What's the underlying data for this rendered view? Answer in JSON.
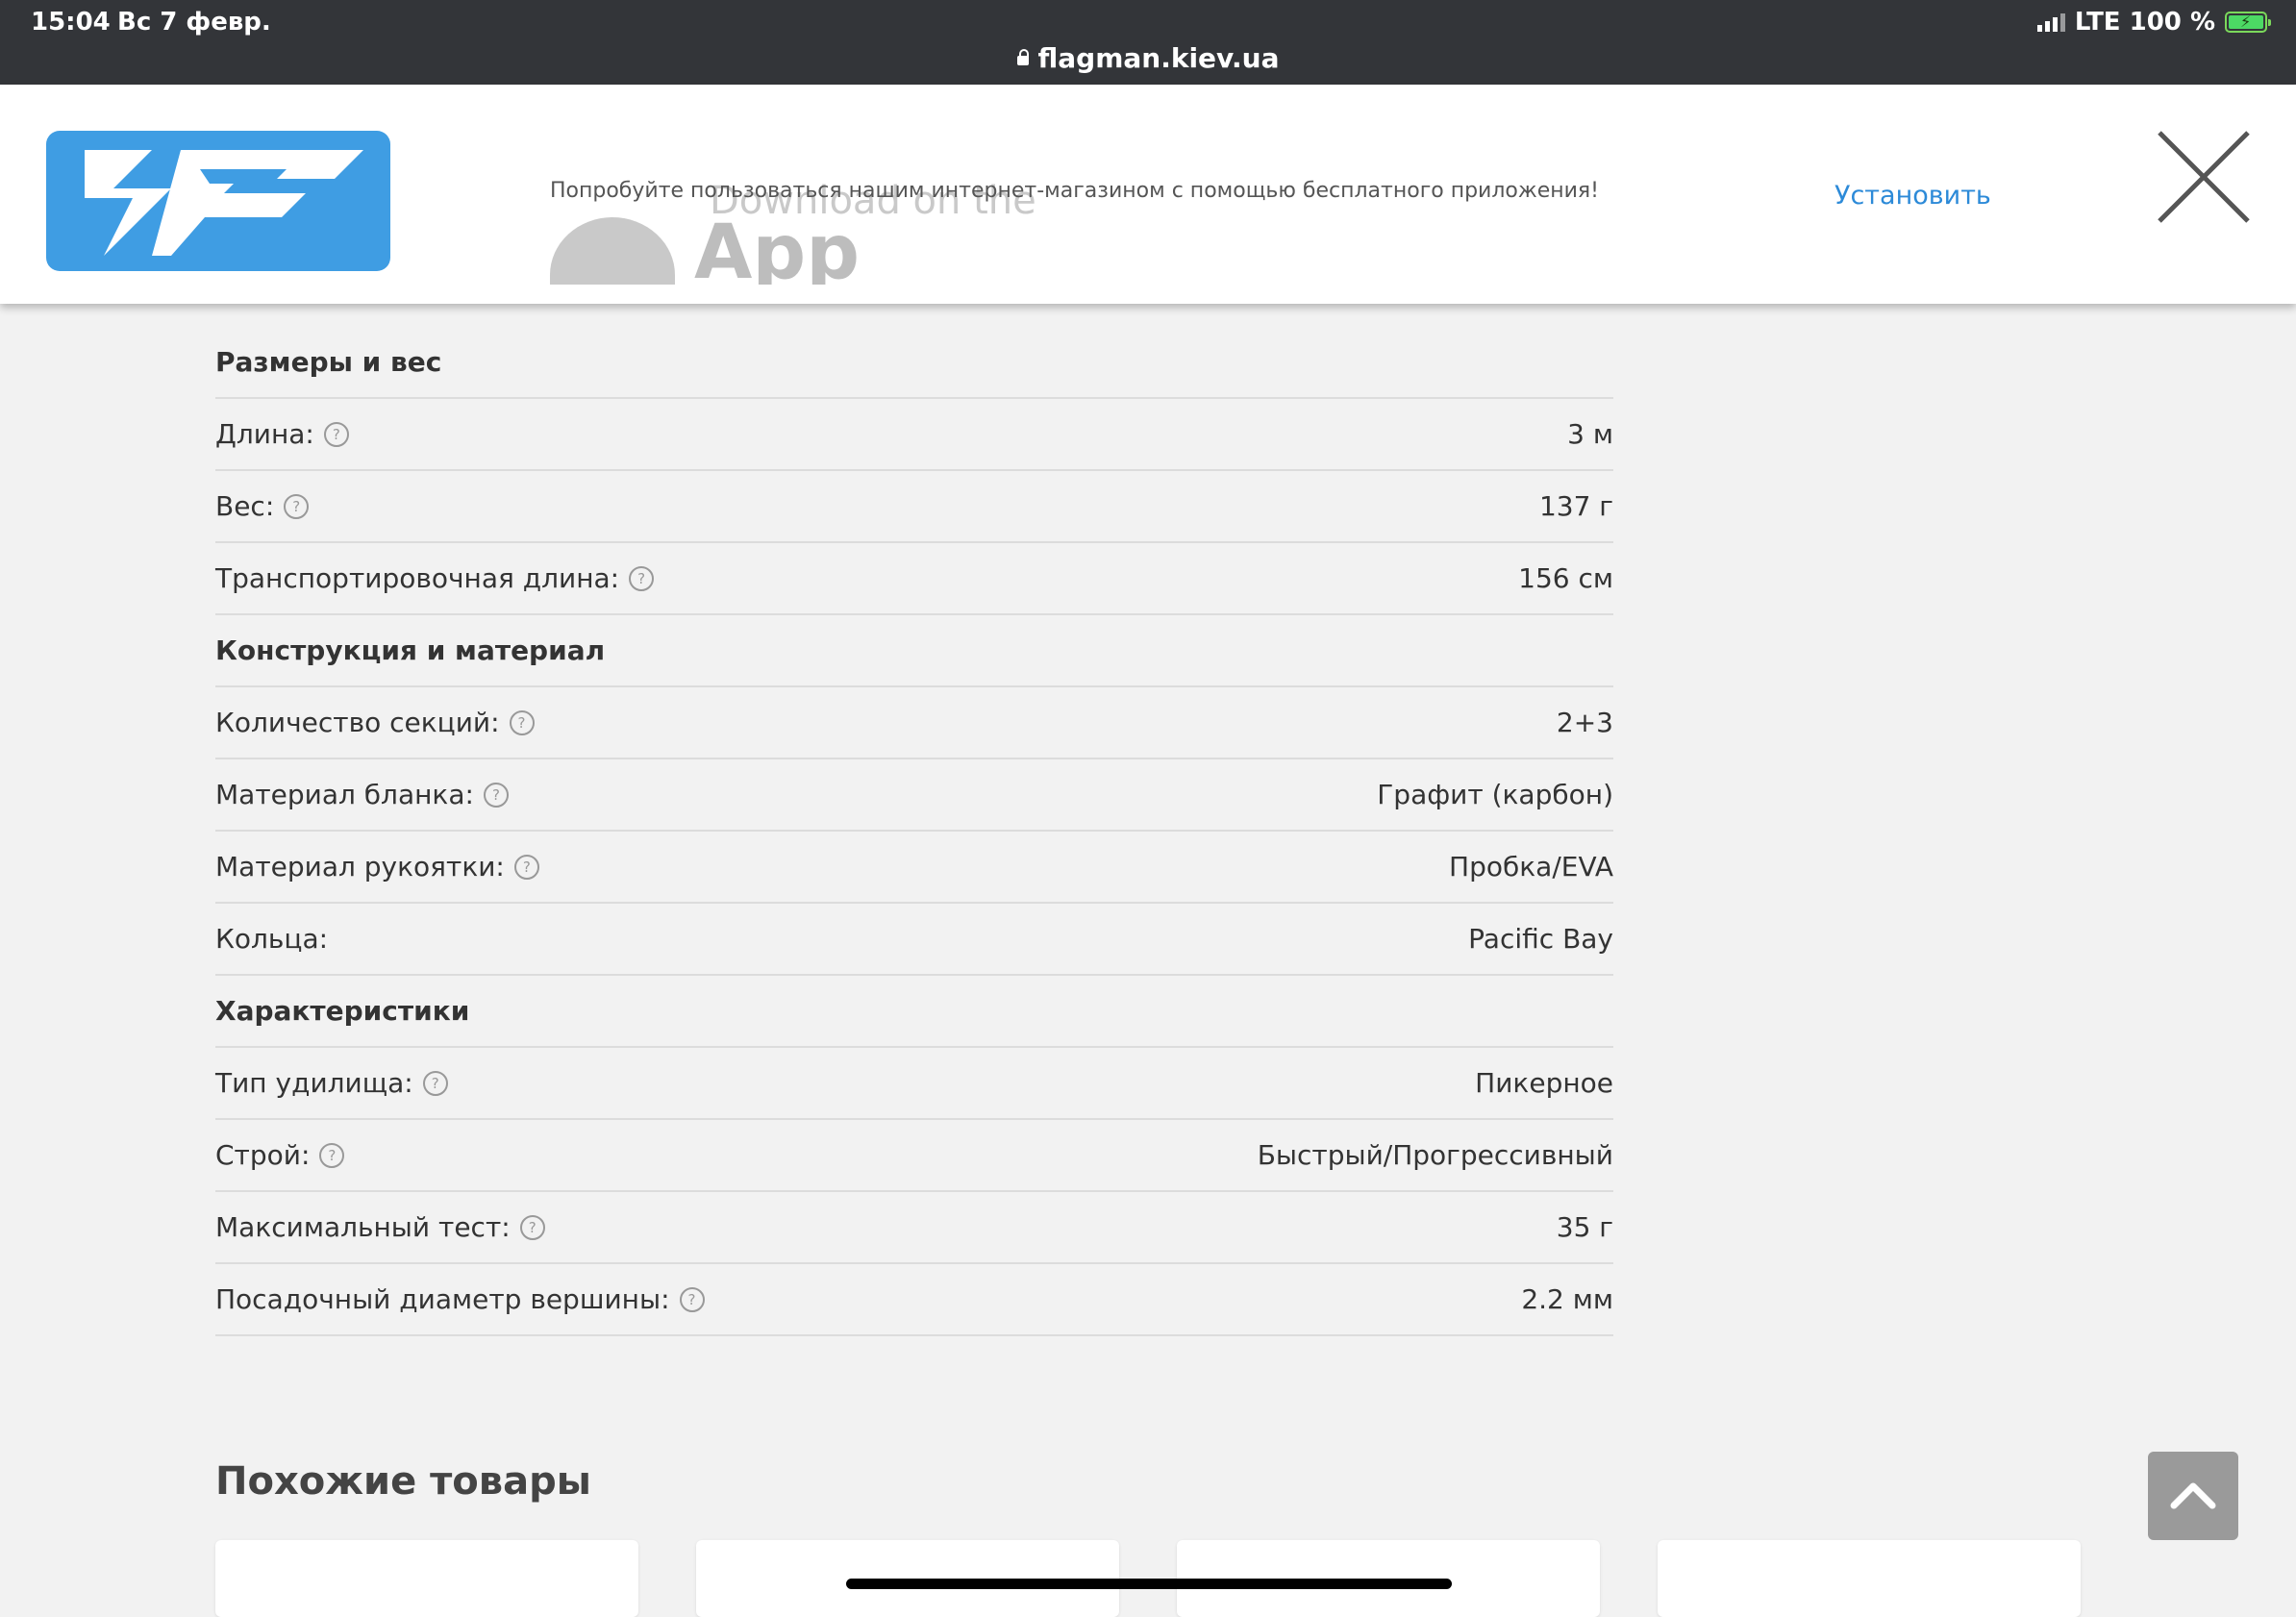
{
  "status_bar": {
    "time": "15:04",
    "date": "Вс 7 февр.",
    "url": "flagman.kiev.ua",
    "network": "LTE 100 %"
  },
  "banner": {
    "promo_text": "Попробуйте пользоваться нашим интернет-магазином с помощью бесплатного приложения!",
    "install_label": "Установить",
    "appstore_small": "Download on the",
    "appstore_large": "App Store"
  },
  "specs": {
    "sections": [
      {
        "title": "Размеры и вес",
        "rows": [
          {
            "label": "Длина:",
            "value": "3 м",
            "help": true
          },
          {
            "label": "Вес:",
            "value": "137 г",
            "help": true
          },
          {
            "label": "Транспортировочная длина:",
            "value": "156 см",
            "help": true
          }
        ]
      },
      {
        "title": "Конструкция и материал",
        "rows": [
          {
            "label": "Количество секций:",
            "value": "2+3",
            "help": true
          },
          {
            "label": "Материал бланка:",
            "value": "Графит (карбон)",
            "help": true
          },
          {
            "label": "Материал рукоятки:",
            "value": "Пробка/EVA",
            "help": true
          },
          {
            "label": "Кольца:",
            "value": "Pacific Bay",
            "help": false
          }
        ]
      },
      {
        "title": "Характеристики",
        "rows": [
          {
            "label": "Тип удилища:",
            "value": "Пикерное",
            "help": true
          },
          {
            "label": "Строй:",
            "value": "Быстрый/Прогрессивный",
            "help": true
          },
          {
            "label": "Максимальный тест:",
            "value": "35 г",
            "help": true
          },
          {
            "label": "Посадочный диаметр вершины:",
            "value": "2.2 мм",
            "help": true
          }
        ]
      }
    ]
  },
  "similar": {
    "title": "Похожие товары"
  },
  "colors": {
    "status_bar": "#333539",
    "accent": "#2c8ad8",
    "logo_bg": "#3f9de3"
  }
}
